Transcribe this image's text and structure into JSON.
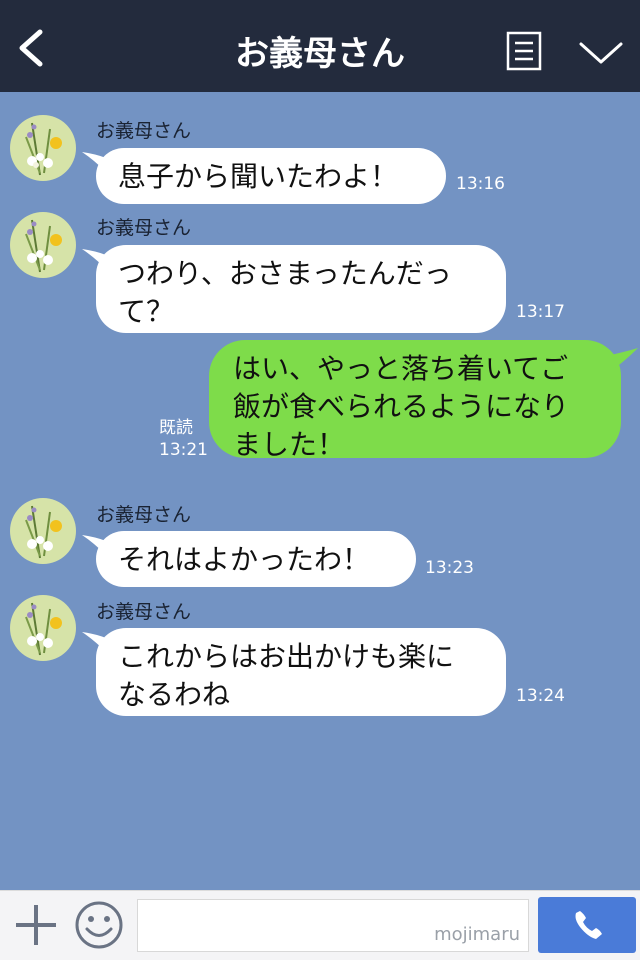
{
  "header": {
    "title": "お義母さん"
  },
  "messages": [
    {
      "sender": "お義母さん",
      "text": "息子から聞いたわよ！",
      "time": "13:16"
    },
    {
      "sender": "お義母さん",
      "line1": "つわり、おさまったんだっ",
      "line2": "て？",
      "time": "13:17"
    },
    {
      "sender": "me",
      "line1": "はい、やっと落ち着いてご",
      "line2": "飯が食べられるようになり",
      "line3": "ました！",
      "read_label": "既読",
      "time": "13:21"
    },
    {
      "sender": "お義母さん",
      "text": "それはよかったわ！",
      "time": "13:23"
    },
    {
      "sender": "お義母さん",
      "line1": "これからはお出かけも楽に",
      "line2": "なるわね",
      "time": "13:24"
    }
  ],
  "footer": {
    "watermark": "mojimaru"
  },
  "colors": {
    "header_bg": "#232b3d",
    "chat_bg": "#7393c3",
    "my_bubble": "#7edc4a",
    "their_bubble": "#ffffff",
    "call_button": "#4a7bd8"
  },
  "icons": {
    "back": "chevron-left-icon",
    "menu": "list-icon",
    "collapse": "chevron-down-icon",
    "add": "plus-icon",
    "emoji": "smiley-icon",
    "call": "phone-icon"
  }
}
